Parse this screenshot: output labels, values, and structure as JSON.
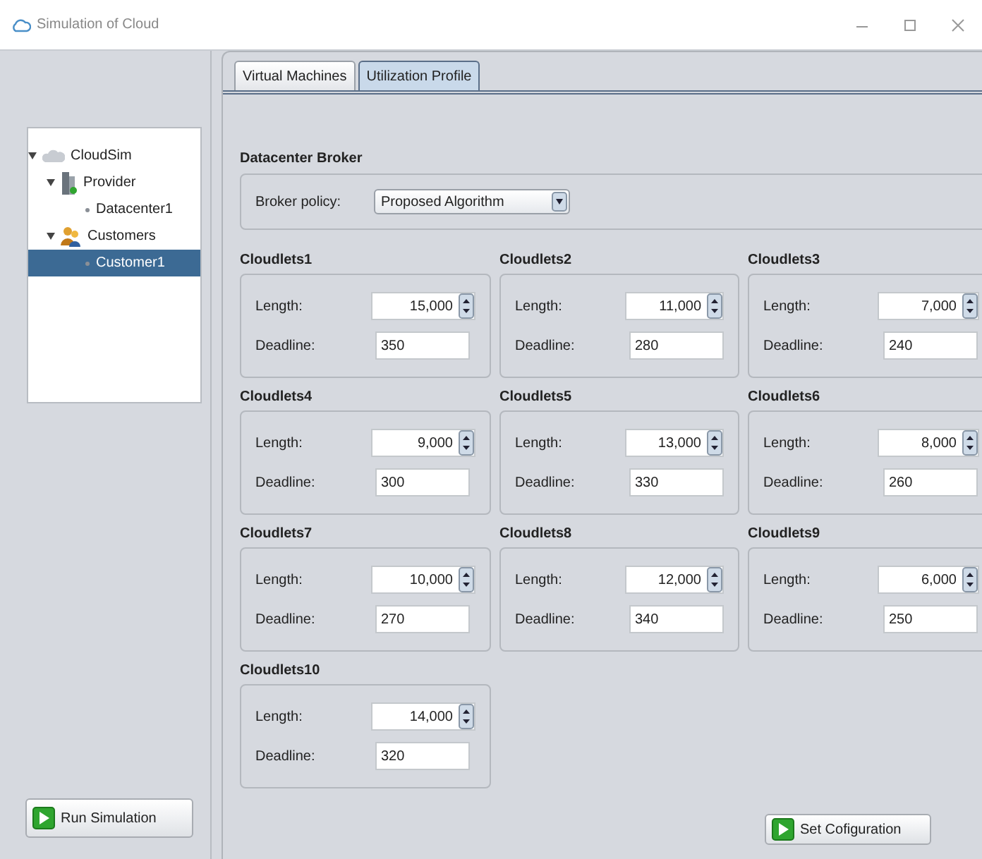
{
  "window": {
    "title": "Simulation of Cloud"
  },
  "tree": [
    {
      "label": "CloudSim",
      "expanded": true,
      "selected": false,
      "children": [
        {
          "label": "Provider",
          "expanded": true,
          "selected": false,
          "children": [
            {
              "label": "Datacenter1",
              "selected": false
            }
          ]
        },
        {
          "label": "Customers",
          "expanded": true,
          "selected": false,
          "children": [
            {
              "label": "Customer1",
              "selected": true
            }
          ]
        }
      ]
    }
  ],
  "run_button": "Run Simulation",
  "tabs": [
    {
      "label": "Virtual Machines",
      "selected": false
    },
    {
      "label": "Utilization Profile",
      "selected": true
    }
  ],
  "broker": {
    "title": "Datacenter Broker",
    "label": "Broker policy:",
    "value": "Proposed Algorithm"
  },
  "cloudlets": [
    {
      "title": "Cloudlets1",
      "length_label": "Length:",
      "length": "15,000",
      "deadline_label": "Deadline:",
      "deadline": "350"
    },
    {
      "title": "Cloudlets2",
      "length_label": "Length:",
      "length": "11,000",
      "deadline_label": "Deadline:",
      "deadline": "280"
    },
    {
      "title": "Cloudlets3",
      "length_label": "Length:",
      "length": "7,000",
      "deadline_label": "Deadline:",
      "deadline": "240"
    },
    {
      "title": "Cloudlets4",
      "length_label": "Length:",
      "length": "9,000",
      "deadline_label": "Deadline:",
      "deadline": "300"
    },
    {
      "title": "Cloudlets5",
      "length_label": "Length:",
      "length": "13,000",
      "deadline_label": "Deadline:",
      "deadline": "330"
    },
    {
      "title": "Cloudlets6",
      "length_label": "Length:",
      "length": "8,000",
      "deadline_label": "Deadline:",
      "deadline": "260"
    },
    {
      "title": "Cloudlets7",
      "length_label": "Length:",
      "length": "10,000",
      "deadline_label": "Deadline:",
      "deadline": "270"
    },
    {
      "title": "Cloudlets8",
      "length_label": "Length:",
      "length": "12,000",
      "deadline_label": "Deadline:",
      "deadline": "340"
    },
    {
      "title": "Cloudlets9",
      "length_label": "Length:",
      "length": "6,000",
      "deadline_label": "Deadline:",
      "deadline": "250"
    },
    {
      "title": "Cloudlets10",
      "length_label": "Length:",
      "length": "14,000",
      "deadline_label": "Deadline:",
      "deadline": "320"
    }
  ],
  "set_button": "Set Cofiguration"
}
